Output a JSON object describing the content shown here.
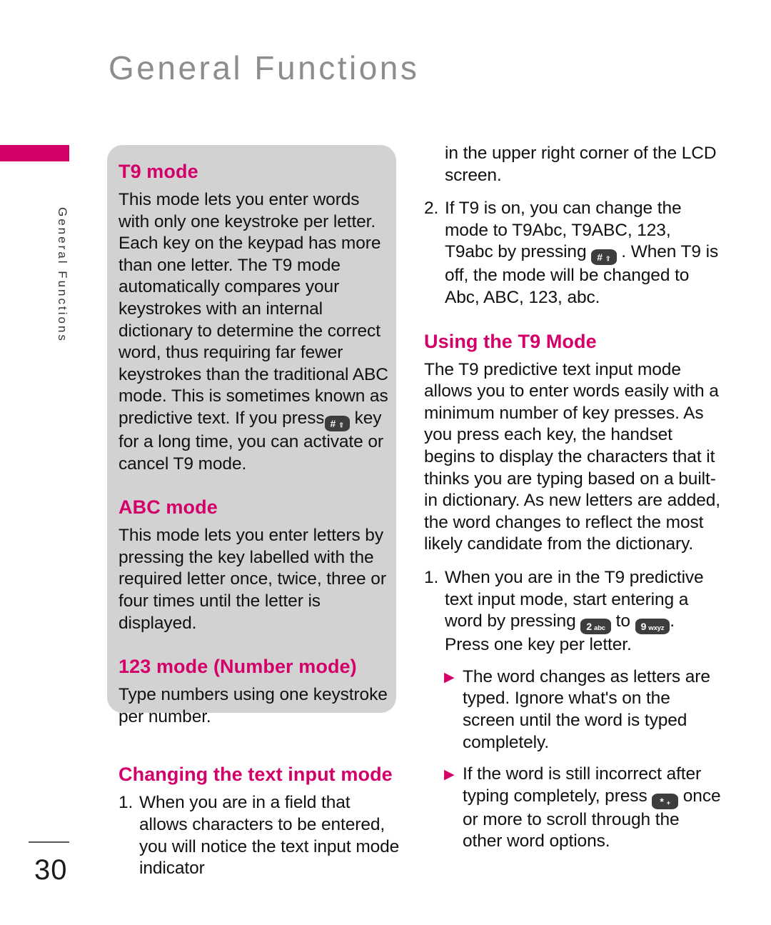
{
  "page": {
    "header_title": "General Functions",
    "sidebar_label": "General Functions",
    "page_number": "30",
    "accent_color": "#d4006a",
    "panel_color": "#d2d2d2",
    "header_color": "#8d8d8d"
  },
  "keys": {
    "hash": {
      "main": "#",
      "sub": "shift-glyph",
      "name": "hash-key-icon"
    },
    "two": {
      "main": "2",
      "sub": "abc",
      "name": "key-2-abc-icon"
    },
    "nine": {
      "main": "9",
      "sub": "wxyz",
      "name": "key-9-wxyz-icon"
    },
    "star": {
      "main": "*",
      "sub": "+",
      "name": "star-key-icon"
    }
  },
  "left_column": {
    "sections": [
      {
        "heading": "T9 mode",
        "body_before_key": "This mode lets you enter words with only one keystroke per letter. Each key on the keypad has more than one letter. The T9 mode automatically compares your keystrokes with an internal dictionary to determine the correct word, thus requiring far fewer keystrokes than the traditional ABC mode. This is sometimes known as predictive text. If you press",
        "body_after_key": "key for a long time, you can activate or cancel T9 mode."
      },
      {
        "heading": "ABC mode",
        "body": "This mode lets you enter letters by pressing the key labelled with the required letter once, twice, three or four times until the letter is displayed."
      },
      {
        "heading": "123 mode (Number mode)",
        "body": "Type numbers using one keystroke per number."
      }
    ],
    "changing_mode": {
      "heading": "Changing the text input mode",
      "item_1_marker": "1.",
      "item_1_text": "When you are in a field that allows characters to be entered, you will notice the text input mode indicator"
    }
  },
  "right_column": {
    "continued_text": "in the upper right corner of the LCD screen.",
    "item_2_marker": "2.",
    "item_2_before_key": "If T9 is on, you can change the mode to T9Abc, T9ABC, 123, T9abc by pressing",
    "item_2_after_key": ". When T9 is off, the mode will be changed to Abc, ABC, 123, abc.",
    "using_t9": {
      "heading": "Using the T9 Mode",
      "body": "The T9 predictive text input mode allows you to enter words easily with a minimum number of key presses. As you press each key, the handset begins to display the characters that it thinks you are typing based on a built-in dictionary. As new letters are added, the word changes to reflect the most likely candidate from the dictionary.",
      "item_1_marker": "1.",
      "item_1_part_a": "When you are in the T9 predictive text input mode, start entering a word by pressing",
      "item_1_part_b": "to",
      "item_1_part_c": ". Press one key per letter.",
      "bullets": [
        {
          "marker": "▶",
          "text": "The word changes as letters are typed. Ignore what's on the screen until the word is typed completely."
        },
        {
          "marker": "▶",
          "before_key": "If the word is still incorrect after typing completely, press",
          "after_key": "once or more to scroll through the other word options."
        }
      ]
    }
  }
}
